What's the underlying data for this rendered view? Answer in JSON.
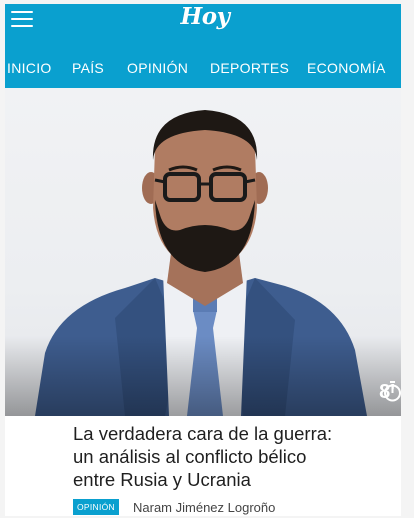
{
  "header": {
    "logo_text": "Hoy",
    "menu_icon": "hamburger-menu-icon",
    "bar_color": "#0aa0cf"
  },
  "nav": {
    "items": [
      {
        "label": "INICIO"
      },
      {
        "label": "PAÍS"
      },
      {
        "label": "OPINIÓN"
      },
      {
        "label": "DEPORTES"
      },
      {
        "label": "ECONOMÍA"
      }
    ]
  },
  "article": {
    "read_time": "8'",
    "read_time_icon": "stopwatch-icon",
    "headline_lines": [
      "La verdadera cara de la guerra:",
      "un análisis al conflicto bélico",
      "entre Rusia y Ucrania"
    ],
    "category_badge": "OPINIÓN",
    "author": "Naram Jiménez Logroño"
  }
}
